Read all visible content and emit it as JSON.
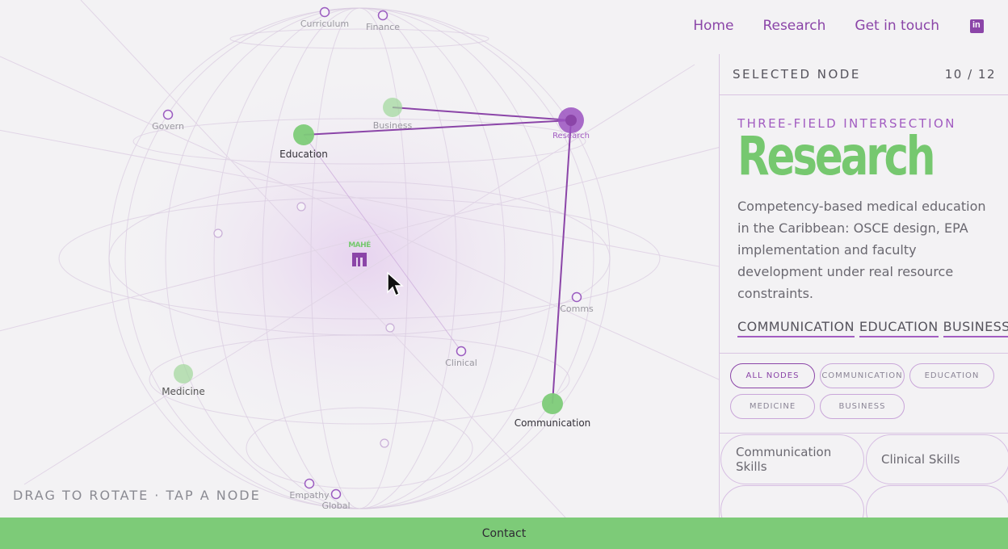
{
  "nav": {
    "home": "Home",
    "research": "Research",
    "contact": "Get in touch",
    "linkedin_icon": "linkedin-icon"
  },
  "globe": {
    "logo_text": "MAHÉ",
    "hint": "DRAG TO ROTATE · TAP A NODE",
    "selected_node": "Research",
    "highlight_edges": [
      "Research-Business",
      "Research-Education",
      "Research-Communication"
    ],
    "nodes": [
      {
        "id": "curriculum",
        "label": "Curriculum",
        "style": "ring"
      },
      {
        "id": "finance",
        "label": "Finance",
        "style": "ring"
      },
      {
        "id": "govern",
        "label": "Govern",
        "style": "ring"
      },
      {
        "id": "business",
        "label": "Business",
        "style": "green-faded"
      },
      {
        "id": "education",
        "label": "Education",
        "style": "green"
      },
      {
        "id": "research",
        "label": "Research",
        "style": "purple"
      },
      {
        "id": "comms",
        "label": "Comms",
        "style": "ring"
      },
      {
        "id": "clinical",
        "label": "Clinical",
        "style": "ring"
      },
      {
        "id": "medicine",
        "label": "Medicine",
        "style": "green-faded"
      },
      {
        "id": "communication",
        "label": "Communication",
        "style": "green"
      },
      {
        "id": "empathy",
        "label": "Empathy",
        "style": "ring"
      },
      {
        "id": "global",
        "label": "Global",
        "style": "ring"
      },
      {
        "id": "u1",
        "label": "",
        "style": "ring-faint"
      },
      {
        "id": "u2",
        "label": "",
        "style": "ring-faint"
      },
      {
        "id": "u3",
        "label": "",
        "style": "ring-faint"
      },
      {
        "id": "u4",
        "label": "",
        "style": "ring-faint"
      }
    ]
  },
  "panel": {
    "title": "SELECTED NODE",
    "count": "10 / 12",
    "eyebrow": "THREE-FIELD INTERSECTION",
    "heading": "Research",
    "description": "Competency-based medical education in the Caribbean: OSCE design, EPA implementation and faculty development under real resource constraints.",
    "tags": [
      "COMMUNICATION",
      "EDUCATION",
      "BUSINESS"
    ],
    "filters": [
      "ALL NODES",
      "COMMUNICATION",
      "EDUCATION",
      "MEDICINE",
      "BUSINESS"
    ],
    "active_filter": "ALL NODES",
    "cards": [
      "Communication Skills",
      "Clinical Skills"
    ]
  },
  "footer": {
    "contact": "Contact"
  },
  "colors": {
    "purple": "#8b45a8",
    "green": "#76c86f",
    "bar": "#7dcb78"
  }
}
